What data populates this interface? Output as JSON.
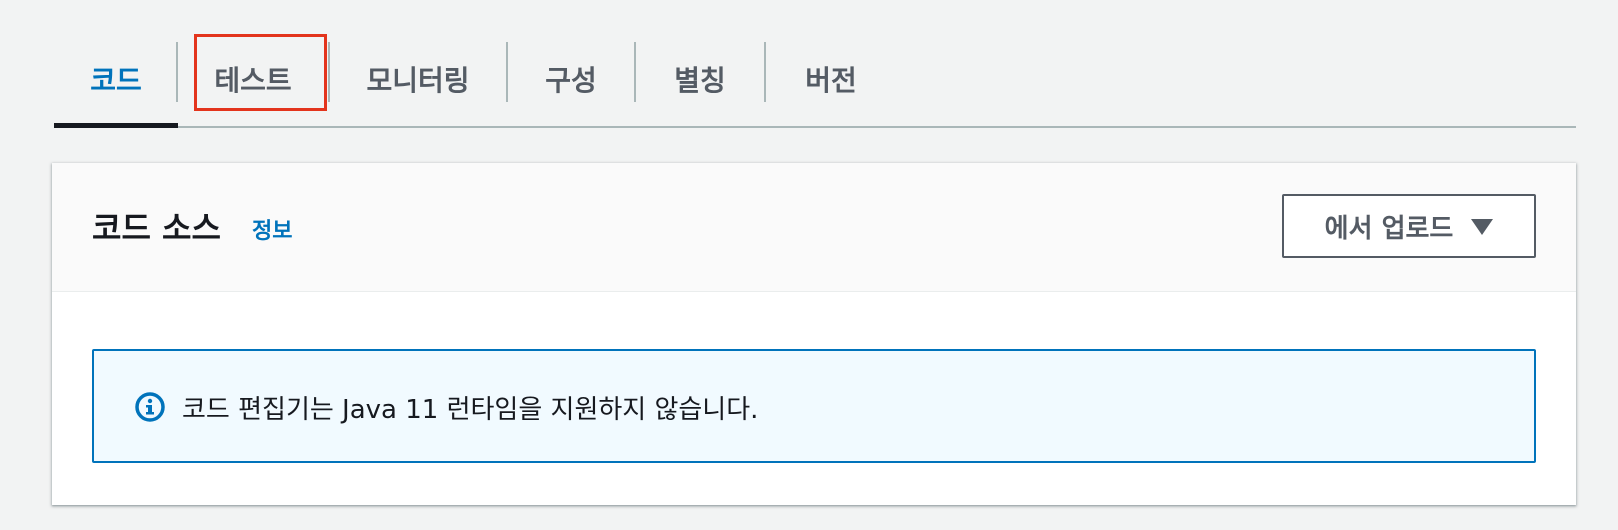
{
  "tabs": [
    {
      "label": "코드",
      "active": true
    },
    {
      "label": "테스트",
      "active": false
    },
    {
      "label": "모니터링",
      "active": false
    },
    {
      "label": "구성",
      "active": false
    },
    {
      "label": "별칭",
      "active": false
    },
    {
      "label": "버전",
      "active": false
    }
  ],
  "panel": {
    "title": "코드 소스",
    "info_link": "정보",
    "upload_button": "에서 업로드"
  },
  "alert": {
    "icon": "info-icon",
    "message": "코드 편집기는 Java 11 런타임을 지원하지 않습니다."
  },
  "colors": {
    "accent": "#0073bb",
    "highlight": "#e3341c",
    "alert_bg": "#f1faff"
  }
}
